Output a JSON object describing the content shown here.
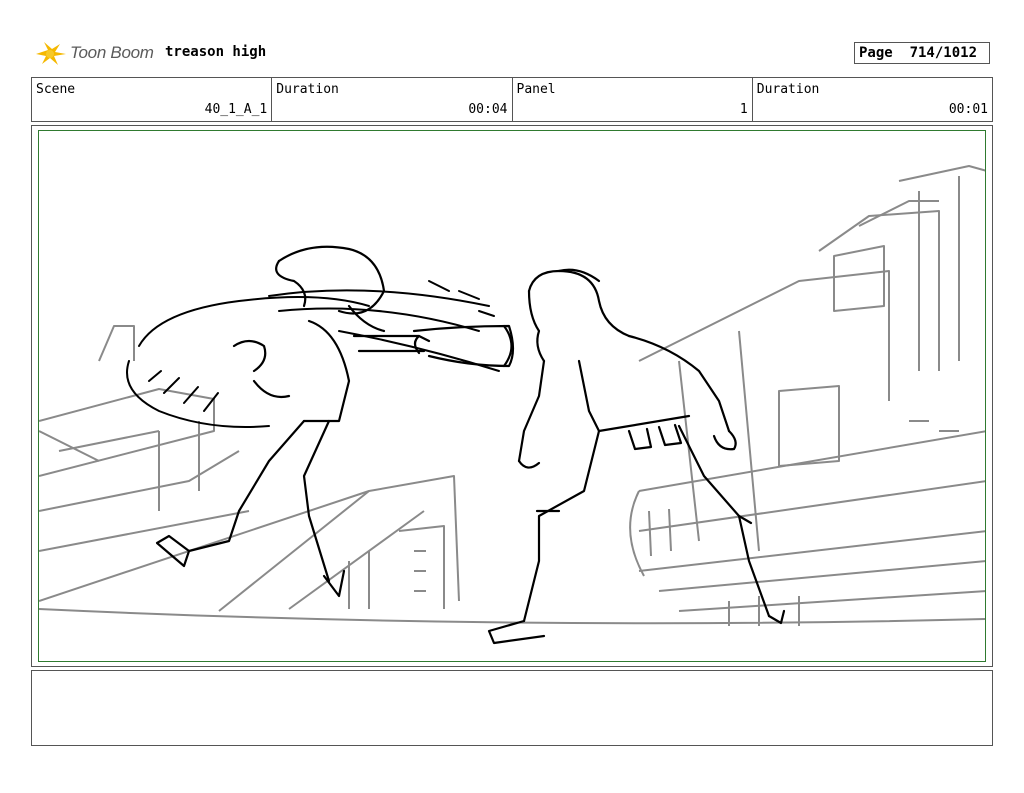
{
  "header": {
    "logo_text": "Toon Boom",
    "project_title": "treason high",
    "page_label": "Page",
    "page_number": "714/1012"
  },
  "info": {
    "scene_label": "Scene",
    "scene_value": "40_1_A_1",
    "duration_label": "Duration",
    "duration_value": "00:04",
    "panel_label": "Panel",
    "panel_value": "1",
    "panel_duration_label": "Duration",
    "panel_duration_value": "00:01"
  },
  "notes": {
    "text": ""
  }
}
